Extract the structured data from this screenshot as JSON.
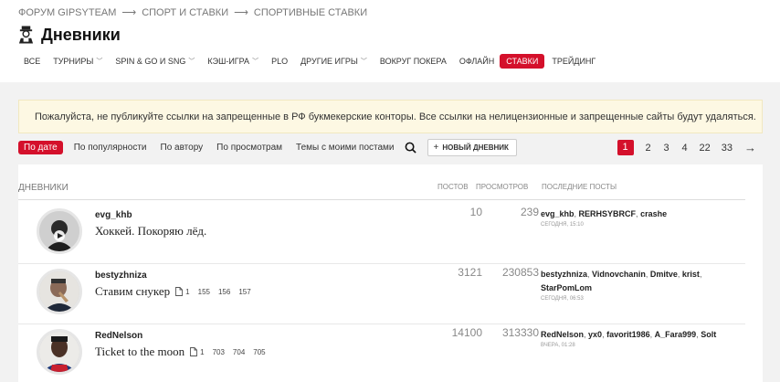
{
  "breadcrumb": [
    "ФОРУМ GIPSYTEAM",
    "СПОРТ И СТАВКИ",
    "СПОРТИВНЫЕ СТАВКИ"
  ],
  "page_title": "Дневники",
  "nav": [
    {
      "label": "ВСЕ",
      "dropdown": false,
      "active": false
    },
    {
      "label": "ТУРНИРЫ",
      "dropdown": true,
      "active": false
    },
    {
      "label": "SPIN & GO И SNG",
      "dropdown": true,
      "active": false
    },
    {
      "label": "КЭШ-ИГРА",
      "dropdown": true,
      "active": false
    },
    {
      "label": "PLO",
      "dropdown": false,
      "active": false
    },
    {
      "label": "ДРУГИЕ ИГРЫ",
      "dropdown": true,
      "active": false
    },
    {
      "label": "ВОКРУГ ПОКЕРА",
      "dropdown": false,
      "active": false
    },
    {
      "label": "ОФЛАЙН",
      "dropdown": false,
      "active": false
    },
    {
      "label": "СТАВКИ",
      "dropdown": false,
      "active": true
    },
    {
      "label": "ТРЕЙДИНГ",
      "dropdown": false,
      "active": false
    }
  ],
  "notice": "Пожалуйста, не публикуйте ссылки на запрещенные в РФ букмекерские конторы. Все ссылки на нелицензионные и запрещенные сайты будут удаляться.",
  "sort_tabs": [
    "По дате",
    "По популярности",
    "По автору",
    "По просмотрам",
    "Темы с моими постами"
  ],
  "new_blog_label": "НОВЫЙ ДНЕВНИК",
  "pagination": {
    "pages": [
      "1",
      "2",
      "3",
      "4",
      "22",
      "33"
    ],
    "current": "1",
    "next": "→"
  },
  "table_headers": {
    "blogs": "ДНЕВНИКИ",
    "posts": "ПОСТОВ",
    "views": "ПРОСМОТРОВ",
    "last_posts": "ПОСЛЕДНИЕ ПОСТЫ"
  },
  "rows": [
    {
      "author": "evg_khb",
      "title": "Хоккей. Покоряю лёд.",
      "pages": [],
      "posts": "10",
      "views": "239",
      "last_authors": [
        "evg_khb",
        "RERHSYBRCF",
        "crashe"
      ],
      "last_time": "СЕГОДНЯ, 15:10"
    },
    {
      "author": "bestyzhniza",
      "title": "Ставим снукер",
      "pages": [
        "1",
        "155",
        "156",
        "157"
      ],
      "posts": "3121",
      "views": "230853",
      "last_authors": [
        "bestyzhniza",
        "Vidnovchanin",
        "Dmitve",
        "krist",
        "StarPomLom"
      ],
      "last_time": "СЕГОДНЯ, 06:53"
    },
    {
      "author": "RedNelson",
      "title": "Ticket to the moon",
      "pages": [
        "1",
        "703",
        "704",
        "705"
      ],
      "posts": "14100",
      "views": "313330",
      "last_authors": [
        "RedNelson",
        "yx0",
        "favorit1986",
        "A_Fara999",
        "Solt"
      ],
      "last_time": "ВЧЕРА, 01:28"
    }
  ],
  "colors": {
    "accent": "#d4102b",
    "notice_bg": "#fdf8e3",
    "page_bg": "#f2f2f2"
  }
}
